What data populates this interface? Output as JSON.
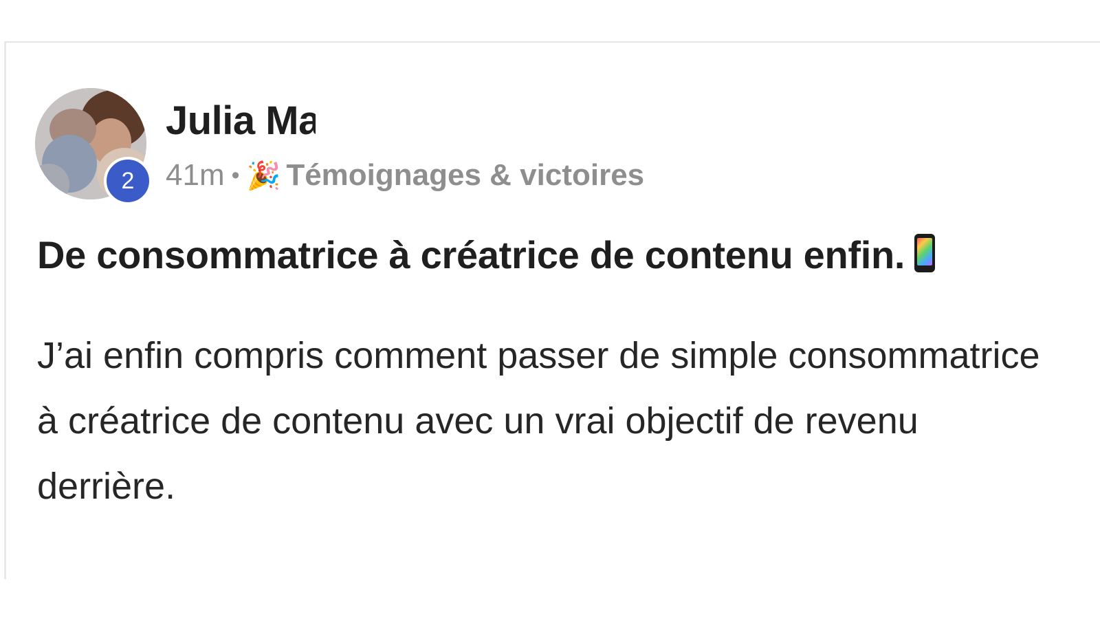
{
  "post": {
    "author": {
      "name": "Julia Ma",
      "level": "2"
    },
    "time": "41m",
    "separator": "•",
    "category_emoji": "🎉",
    "category": "Témoignages & victoires",
    "title": "De consommatrice à créatrice de contenu enfin.",
    "title_emoji_icon": "mobile-phone-icon",
    "body": "J’ai enfin compris comment passer de simple consommatrice à créatrice de contenu avec un vrai objectif de revenu derrière."
  },
  "colors": {
    "badge": "#3b5cc8",
    "meta_text": "#8e8e8e",
    "title_text": "#1f1f1f",
    "body_text": "#262626"
  }
}
